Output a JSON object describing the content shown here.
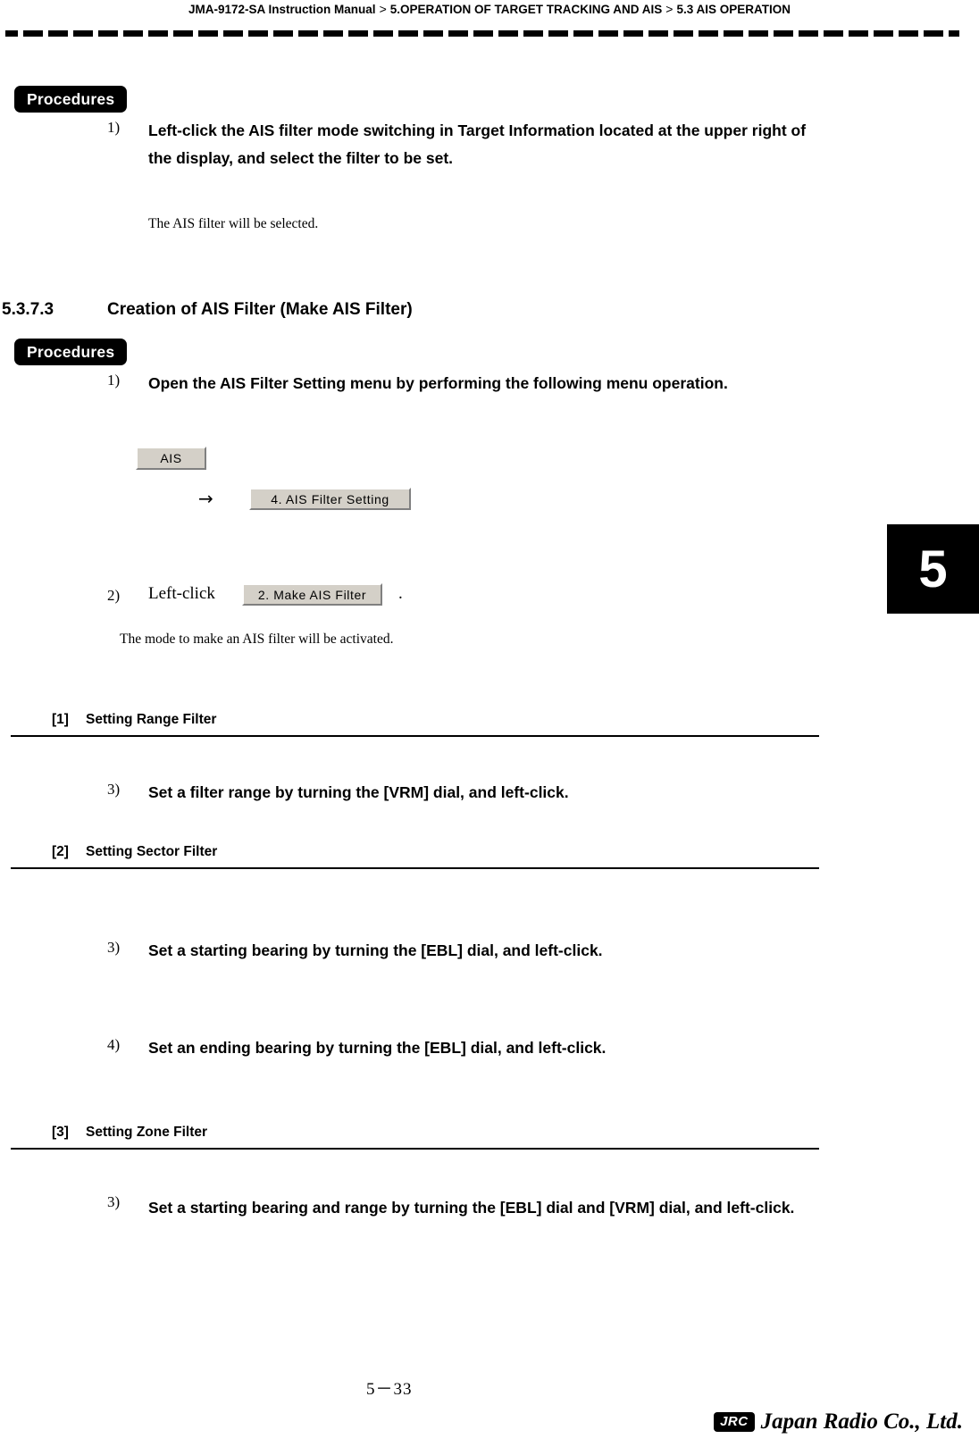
{
  "header": {
    "manual": "JMA-9172-SA Instruction Manual",
    "sep1": ">",
    "chapter": "5.OPERATION OF TARGET TRACKING AND AIS",
    "sep2": ">",
    "section": "5.3  AIS OPERATION"
  },
  "chapter_tab": "5",
  "procedures_label_1": "Procedures",
  "procedures_label_2": "Procedures",
  "step1": {
    "num": "1)",
    "text": "Left-click the  AIS filter mode switching in Target Information located at the upper right of the display, and select the filter to be set.",
    "note": "The AIS filter will be selected."
  },
  "section_heading": {
    "number": "5.3.7.3",
    "title": "Creation of AIS Filter (Make AIS Filter)"
  },
  "step2": {
    "num": "1)",
    "text": "Open the AIS Filter Setting menu by performing the following menu operation."
  },
  "menu": {
    "ais_button": "AIS",
    "arrow": "→",
    "filter_setting_button": "4. AIS Filter Setting"
  },
  "step3": {
    "num": "2)",
    "prefix": "Left-click",
    "button": "2. Make AIS Filter",
    "suffix": ".",
    "note": "The mode to make an AIS filter will be activated."
  },
  "blocks": [
    {
      "tag": "[1]",
      "title": "Setting Range Filter",
      "step_num": "3)",
      "step_text": "Set a filter range by turning the [VRM] dial, and left-click."
    },
    {
      "tag": "[2]",
      "title": "Setting Sector Filter",
      "step_num": "3)",
      "step_text": "Set a starting bearing by turning the [EBL] dial, and left-click.",
      "step_num2": "4)",
      "step_text2": "Set an ending bearing by turning the [EBL] dial, and left-click."
    },
    {
      "tag": "[3]",
      "title": "Setting Zone Filter",
      "step_num": "3)",
      "step_text": "Set a starting bearing and range by turning the [EBL] dial and [VRM] dial, and left-click."
    }
  ],
  "footer": {
    "page": "5－33",
    "logo_box": "JRC",
    "logo_name": "Japan Radio Co., Ltd."
  }
}
